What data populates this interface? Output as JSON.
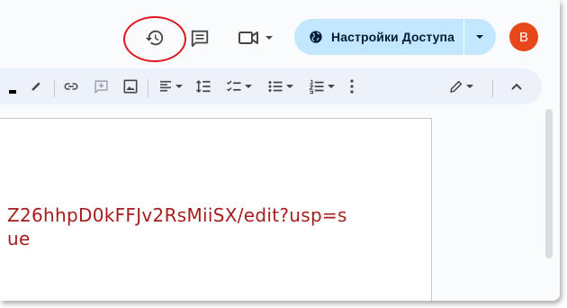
{
  "header": {
    "share_label": "Настройки Доступа",
    "avatar_letter": "B"
  },
  "document": {
    "lines": [
      "Z26hhpD0kFFJv2RsMiiSX/edit?usp=s",
      "ue"
    ]
  },
  "icons": [
    "history-icon",
    "comment-icon",
    "video-call-icon",
    "globe-icon",
    "pen-icon",
    "link-icon",
    "add-comment-icon",
    "image-icon",
    "align-left-icon",
    "line-spacing-icon",
    "checklist-icon",
    "bulleted-list-icon",
    "numbered-list-icon",
    "more-vert-icon",
    "edit-mode-icon",
    "collapse-icon"
  ],
  "colors": {
    "share_bg": "#c2e7ff",
    "avatar_bg": "#e8471a",
    "link_text": "#a61c1c",
    "highlight_ring": "#e0161e",
    "toolbar_bg": "#edf2fa"
  }
}
